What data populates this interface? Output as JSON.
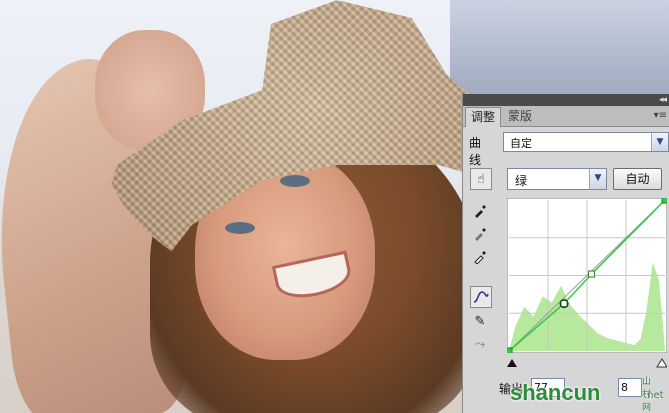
{
  "panel": {
    "tabs": [
      {
        "label": "调整",
        "active": true
      },
      {
        "label": "蒙版",
        "active": false
      }
    ],
    "collapse_glyph": "◂◂",
    "menu_glyph": "▾≡"
  },
  "curves": {
    "label": "曲线",
    "preset": "自定",
    "channel": "绿",
    "auto_button": "自动",
    "output_label": "输出:",
    "output_value": "77",
    "input_value": "8"
  },
  "tools": [
    {
      "name": "on-image-adjust-icon",
      "glyph": "☝"
    },
    {
      "name": "black-eyedropper-icon",
      "glyph": "✒"
    },
    {
      "name": "gray-eyedropper-icon",
      "glyph": "✒"
    },
    {
      "name": "white-eyedropper-icon",
      "glyph": "✒"
    },
    {
      "name": "curve-point-tool-icon",
      "glyph": "∿"
    },
    {
      "name": "pencil-draw-icon",
      "glyph": "✎"
    },
    {
      "name": "smooth-curve-icon",
      "glyph": "⤳"
    }
  ],
  "chart_data": {
    "type": "area",
    "title": "",
    "xlim": [
      0,
      255
    ],
    "ylim": [
      0,
      255
    ],
    "grid": true,
    "colors": {
      "curve": "#2ecc40",
      "histogram": "#b6e89d",
      "background": "#ffffff"
    },
    "histogram": [
      {
        "x": 0,
        "y": 0
      },
      {
        "x": 10,
        "y": 40
      },
      {
        "x": 25,
        "y": 75
      },
      {
        "x": 40,
        "y": 58
      },
      {
        "x": 55,
        "y": 92
      },
      {
        "x": 70,
        "y": 82
      },
      {
        "x": 85,
        "y": 110
      },
      {
        "x": 100,
        "y": 78
      },
      {
        "x": 115,
        "y": 60
      },
      {
        "x": 130,
        "y": 45
      },
      {
        "x": 145,
        "y": 30
      },
      {
        "x": 160,
        "y": 22
      },
      {
        "x": 175,
        "y": 18
      },
      {
        "x": 190,
        "y": 14
      },
      {
        "x": 205,
        "y": 10
      },
      {
        "x": 215,
        "y": 20
      },
      {
        "x": 225,
        "y": 70
      },
      {
        "x": 235,
        "y": 150
      },
      {
        "x": 245,
        "y": 120
      },
      {
        "x": 252,
        "y": 40
      },
      {
        "x": 255,
        "y": 0
      }
    ],
    "curve_points": [
      {
        "x": 0,
        "y": 0
      },
      {
        "x": 90,
        "y": 80
      },
      {
        "x": 135,
        "y": 130
      },
      {
        "x": 255,
        "y": 255
      }
    ],
    "baseline": [
      [
        0,
        0
      ],
      [
        255,
        255
      ]
    ]
  },
  "watermark": {
    "text": "shancun",
    "net": "山村网",
    "tld": ".net"
  },
  "photo": {
    "alt": "woman in straw hat smiling"
  }
}
